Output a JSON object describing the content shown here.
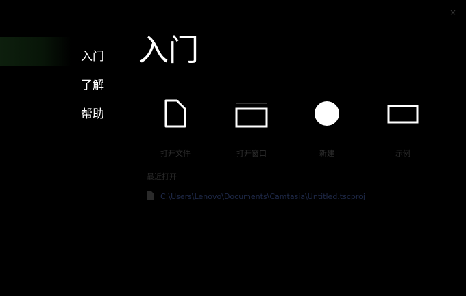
{
  "window": {
    "close_glyph": "×"
  },
  "nav": {
    "items": [
      {
        "label": "入门"
      },
      {
        "label": "了解"
      },
      {
        "label": "帮助"
      }
    ]
  },
  "main": {
    "title": "入门",
    "actions": [
      {
        "icon": "file-icon",
        "label": "打开文件"
      },
      {
        "icon": "window-icon",
        "label": "打开窗口"
      },
      {
        "icon": "circle-icon",
        "label": "新建"
      },
      {
        "icon": "rectangle-icon",
        "label": "示例"
      }
    ],
    "recent": {
      "header": "最近打开",
      "items": [
        {
          "path": "C:\\Users\\Lenovo\\Documents\\Camtasia\\Untitled.tscproj"
        }
      ]
    }
  },
  "colors": {
    "background": "#000000",
    "text": "#ffffff",
    "accent": "#0d1f0d"
  }
}
